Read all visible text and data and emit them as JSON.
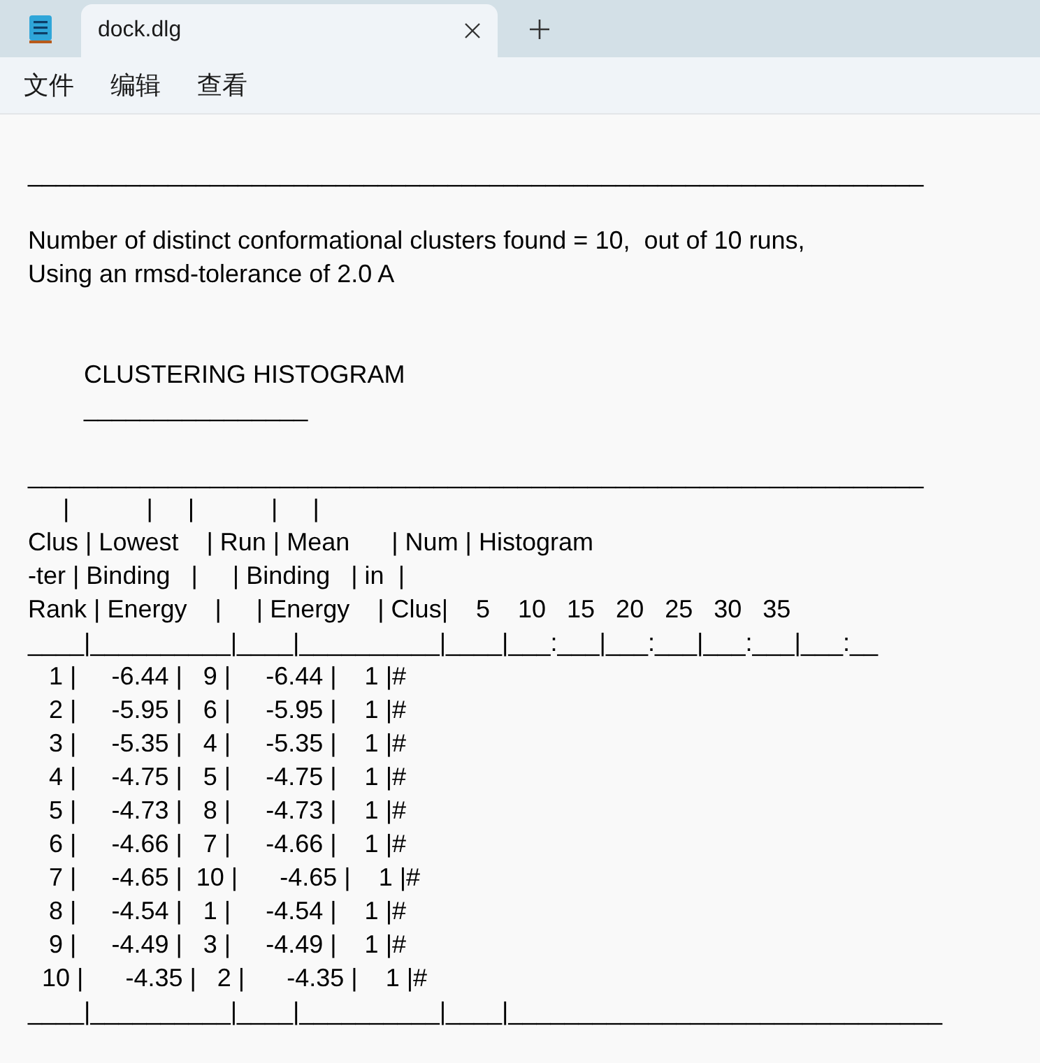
{
  "window": {
    "tab_title": "dock.dlg"
  },
  "menu": [
    "文件",
    "编辑",
    "查看"
  ],
  "lines": [
    {
      "kind": "blank"
    },
    {
      "kind": "text",
      "text": "________________________________________________________________"
    },
    {
      "kind": "blank"
    },
    {
      "kind": "text",
      "text": "Number of distinct conformational clusters found = 10,  out of 10 runs,"
    },
    {
      "kind": "text",
      "text": "Using an rmsd-tolerance of 2.0 A"
    },
    {
      "kind": "blank"
    },
    {
      "kind": "blank"
    },
    {
      "kind": "text",
      "text": "        CLUSTERING HISTOGRAM"
    },
    {
      "kind": "text",
      "text": "        ________________"
    },
    {
      "kind": "blank"
    },
    {
      "kind": "text",
      "text": "________________________________________________________________"
    },
    {
      "kind": "text",
      "text": "     |           |     |           |     |"
    },
    {
      "kind": "text",
      "text": "Clus | Lowest    | Run | Mean      | Num | Histogram"
    },
    {
      "kind": "text",
      "text": "-ter | Binding   |     | Binding   | in  |"
    },
    {
      "kind": "text",
      "text": "Rank | Energy    |     | Energy    | Clus|    5    10   15   20   25   30   35"
    },
    {
      "kind": "text",
      "text": "____|__________|____|__________|____|___:___|___:___|___:___|___:__"
    },
    {
      "kind": "text",
      "text": "   1 |     -6.44 |   9 |     -6.44 |    1 |#"
    },
    {
      "kind": "text",
      "text": "   2 |     -5.95 |   6 |     -5.95 |    1 |#"
    },
    {
      "kind": "text",
      "text": "   3 |     -5.35 |   4 |     -5.35 |    1 |#"
    },
    {
      "kind": "text",
      "text": "   4 |     -4.75 |   5 |     -4.75 |    1 |#"
    },
    {
      "kind": "text",
      "text": "   5 |     -4.73 |   8 |     -4.73 |    1 |#"
    },
    {
      "kind": "text",
      "text": "   6 |     -4.66 |   7 |     -4.66 |    1 |#"
    },
    {
      "kind": "text",
      "text": "   7 |     -4.65 |  10 |      -4.65 |    1 |#"
    },
    {
      "kind": "text",
      "text": "   8 |     -4.54 |   1 |     -4.54 |    1 |#"
    },
    {
      "kind": "text",
      "text": "   9 |     -4.49 |   3 |     -4.49 |    1 |#"
    },
    {
      "kind": "text",
      "text": "  10 |      -4.35 |   2 |      -4.35 |    1 |#"
    },
    {
      "kind": "text",
      "text": "____|__________|____|__________|____|_______________________________"
    }
  ]
}
